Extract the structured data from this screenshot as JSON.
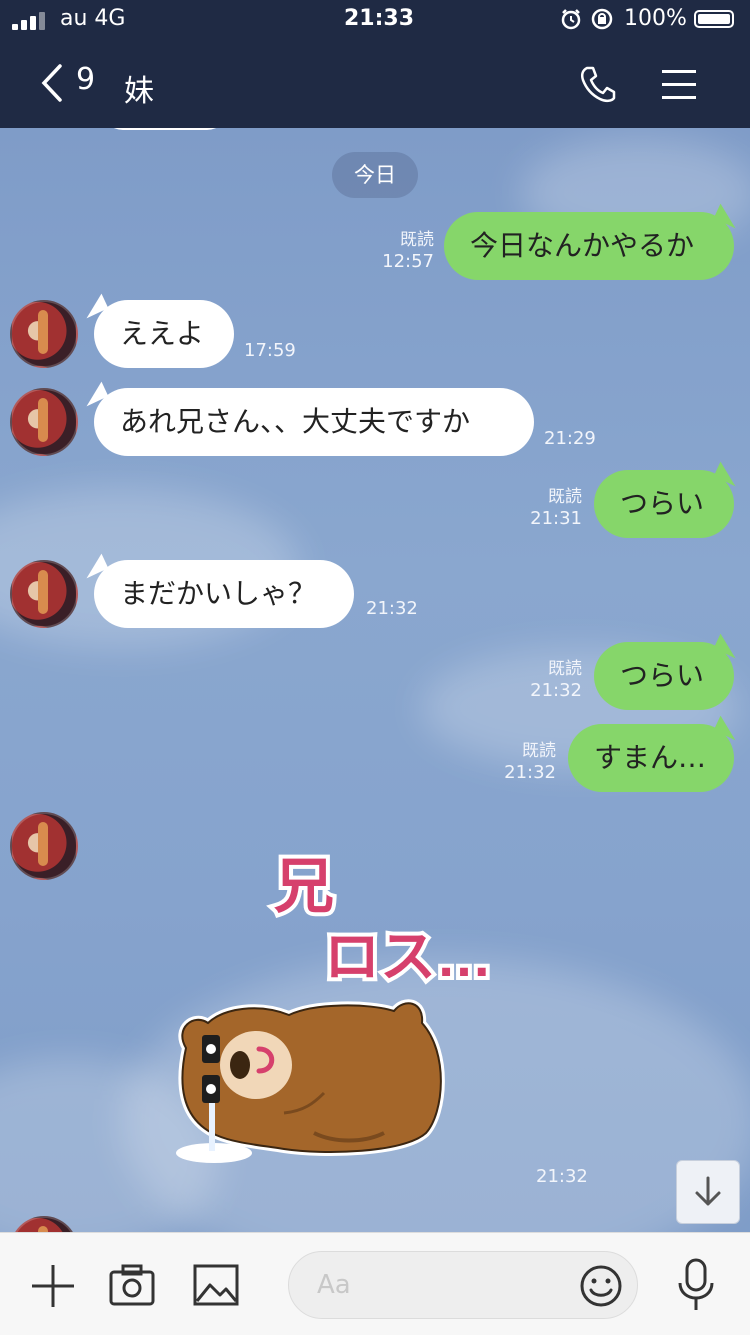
{
  "status_bar": {
    "carrier": "au 4G",
    "time": "21:33",
    "battery": "100%"
  },
  "header": {
    "back_count": "9",
    "title": "妹",
    "call_icon": "phone-icon",
    "menu_icon": "menu-icon"
  },
  "chat": {
    "date_label": "今日",
    "messages": [
      {
        "from": "me",
        "text": "今日なんかやるか",
        "read": "既読",
        "time": "12:57"
      },
      {
        "from": "them",
        "text": "ええよ",
        "time": "17:59"
      },
      {
        "from": "them",
        "text": "あれ兄さん、、大丈夫ですか",
        "time": "21:29"
      },
      {
        "from": "me",
        "text": "つらい",
        "read": "既読",
        "time": "21:31"
      },
      {
        "from": "them",
        "text": "まだかいしゃ？",
        "time": "21:32"
      },
      {
        "from": "me",
        "text": "つらい",
        "read": "既読",
        "time": "21:32"
      },
      {
        "from": "me",
        "text": "すまん…",
        "read": "既読",
        "time": "21:32"
      },
      {
        "from": "them",
        "sticker": {
          "line1": "兄",
          "line2": "ロス…"
        },
        "time": "21:32"
      }
    ]
  },
  "bottom_bar": {
    "input_placeholder": "Aa",
    "icons": [
      "plus-icon",
      "camera-icon",
      "image-icon",
      "emoji-icon",
      "mic-icon"
    ]
  },
  "colors": {
    "header_bg": "#1f2a44",
    "outgoing_bubble": "#86d66a",
    "incoming_bubble": "#ffffff",
    "chat_bg": "#7f9cc7"
  }
}
